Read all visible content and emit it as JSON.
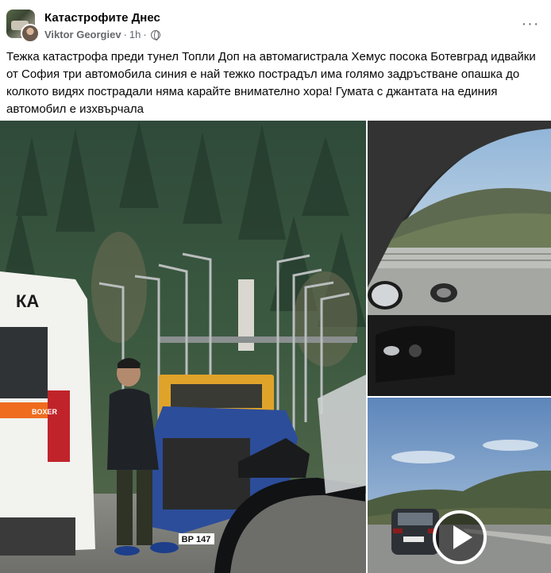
{
  "post": {
    "group_name": "Катастрофите Днес",
    "author": "Viktor Georgiev",
    "separator": "·",
    "time": "1h",
    "privacy_icon": "globe-icon",
    "more_icon": "more-dots-icon",
    "more_label": "···",
    "text": "Тежка катастрофа преди тунел Топли Доп на автомагистрала Хемус посока Ботевград идвайки от София три автомобила синия е най тежко пострадъл има голямо задръстване опашка до колкото видях пострадали няма карайте внимателно хора! Гумата с джантата на единия автомобил е изхвърчала"
  },
  "media": {
    "photos": [
      {
        "name": "accident-scene-photo",
        "ambulance_label": "КА",
        "ambulance_brand": "BOXER",
        "plate": "ВР 147"
      },
      {
        "name": "car-interior-wheel-photo"
      },
      {
        "name": "highway-video-thumbnail",
        "play_icon": "play-icon"
      }
    ]
  }
}
